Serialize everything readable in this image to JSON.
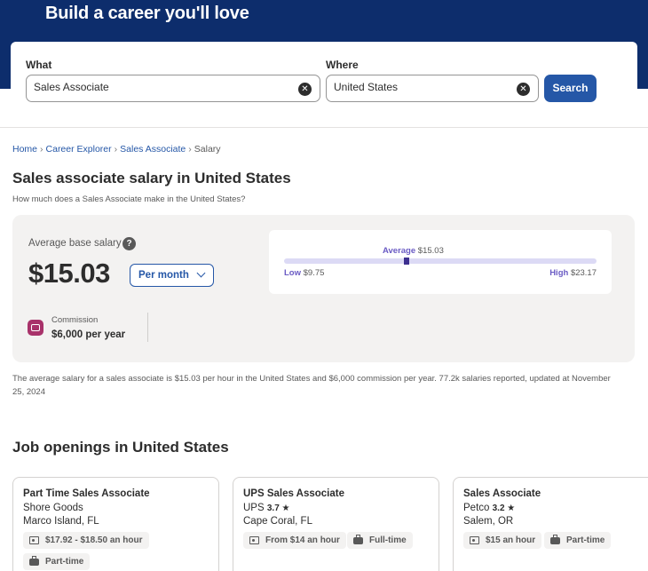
{
  "hero": {
    "title": "Build a career you'll love"
  },
  "search": {
    "what_label": "What",
    "what_value": "Sales Associate",
    "where_label": "Where",
    "where_value": "United States",
    "button_label": "Search"
  },
  "breadcrumb": {
    "items": [
      "Home",
      "Career Explorer",
      "Sales Associate",
      "Salary"
    ],
    "separator": "›"
  },
  "page": {
    "title": "Sales associate salary in United States",
    "subtitle": "How much does a Sales Associate make in the United States?"
  },
  "salary": {
    "average_label": "Average base salary",
    "value": "$15.03",
    "period": "Per month",
    "commission_label": "Commission",
    "commission_value": "$6,000 per year",
    "range": {
      "average_label": "Average",
      "average_value": "$15.03",
      "low_label": "Low",
      "low_value": "$9.75",
      "high_label": "High",
      "high_value": "$23.17",
      "low": 9.75,
      "average": 15.03,
      "high": 23.17
    },
    "summary": "The average salary for a sales associate is $15.03 per hour in the United States and $6,000 commission per year. 77.2k salaries reported, updated at November 25, 2024"
  },
  "jobs": {
    "title": "Job openings in United States",
    "cards": [
      {
        "title": "Part Time Sales Associate",
        "company": "Shore Goods",
        "rating": "",
        "location": "Marco Island, FL",
        "pay": "$17.92 - $18.50 an hour",
        "type": "Part-time"
      },
      {
        "title": "UPS Sales Associate",
        "company": "UPS",
        "rating": "3.7 ★",
        "location": "Cape Coral, FL",
        "pay": "From $14 an hour",
        "type": "Full-time"
      },
      {
        "title": "Sales Associate",
        "company": "Petco",
        "rating": "3.2 ★",
        "location": "Salem, OR",
        "pay": "$15 an hour",
        "type": "Part-time"
      }
    ]
  },
  "colors": {
    "hero_bg": "#0d2d6c",
    "primary_blue": "#2557a7",
    "range_accent": "#6a5bc4",
    "commission_icon": "#a8326a",
    "panel_bg": "#f3f2f1"
  },
  "icons": [
    "clear-icon",
    "help-icon",
    "chevron-down-icon",
    "commission-icon",
    "money-icon",
    "briefcase-icon"
  ]
}
